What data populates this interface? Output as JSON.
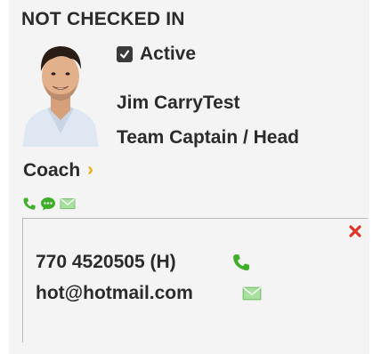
{
  "status_label": "NOT CHECKED IN",
  "active": {
    "label": "Active",
    "checked": true
  },
  "member": {
    "name": "Jim CarryTest",
    "role_line1": "Team Captain / Head",
    "role_line2": "Coach"
  },
  "contact": {
    "phone": "770 4520505 (H)",
    "email": "hot@hotmail.com"
  },
  "icons": {
    "chevron": "chevron-right-icon",
    "phone": "phone-icon",
    "chat": "chat-icon",
    "mail": "mail-icon",
    "close": "close-icon"
  },
  "colors": {
    "green": "#3fae2a",
    "chevron": "#f0a500",
    "close": "#e0352b",
    "text": "#2b2b2b"
  }
}
